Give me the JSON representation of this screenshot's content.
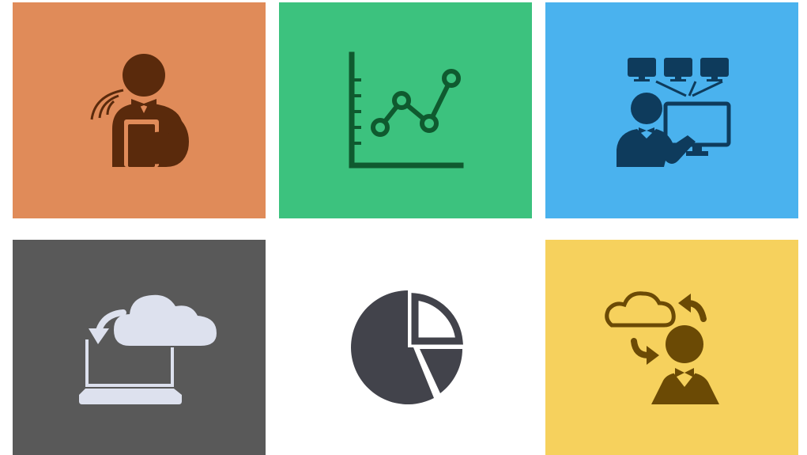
{
  "tiles": [
    {
      "icon": "waiter-tablet-icon",
      "background": "#E08B59",
      "foreground": "#5A2A0C"
    },
    {
      "icon": "line-chart-icon",
      "background": "#3CC27E",
      "foreground": "#0F5A2F"
    },
    {
      "icon": "presenter-monitors-icon",
      "background": "#4AB2EE",
      "foreground": "#0E3B5C"
    },
    {
      "icon": "laptop-cloud-download-icon",
      "background": "#595959",
      "foreground": "#DDE1EE"
    },
    {
      "icon": "pie-chart-icon",
      "background": "#FFFFFF",
      "foreground": "#42434B"
    },
    {
      "icon": "person-cloud-sync-icon",
      "background": "#F6D15D",
      "foreground": "#6B4A05"
    }
  ]
}
